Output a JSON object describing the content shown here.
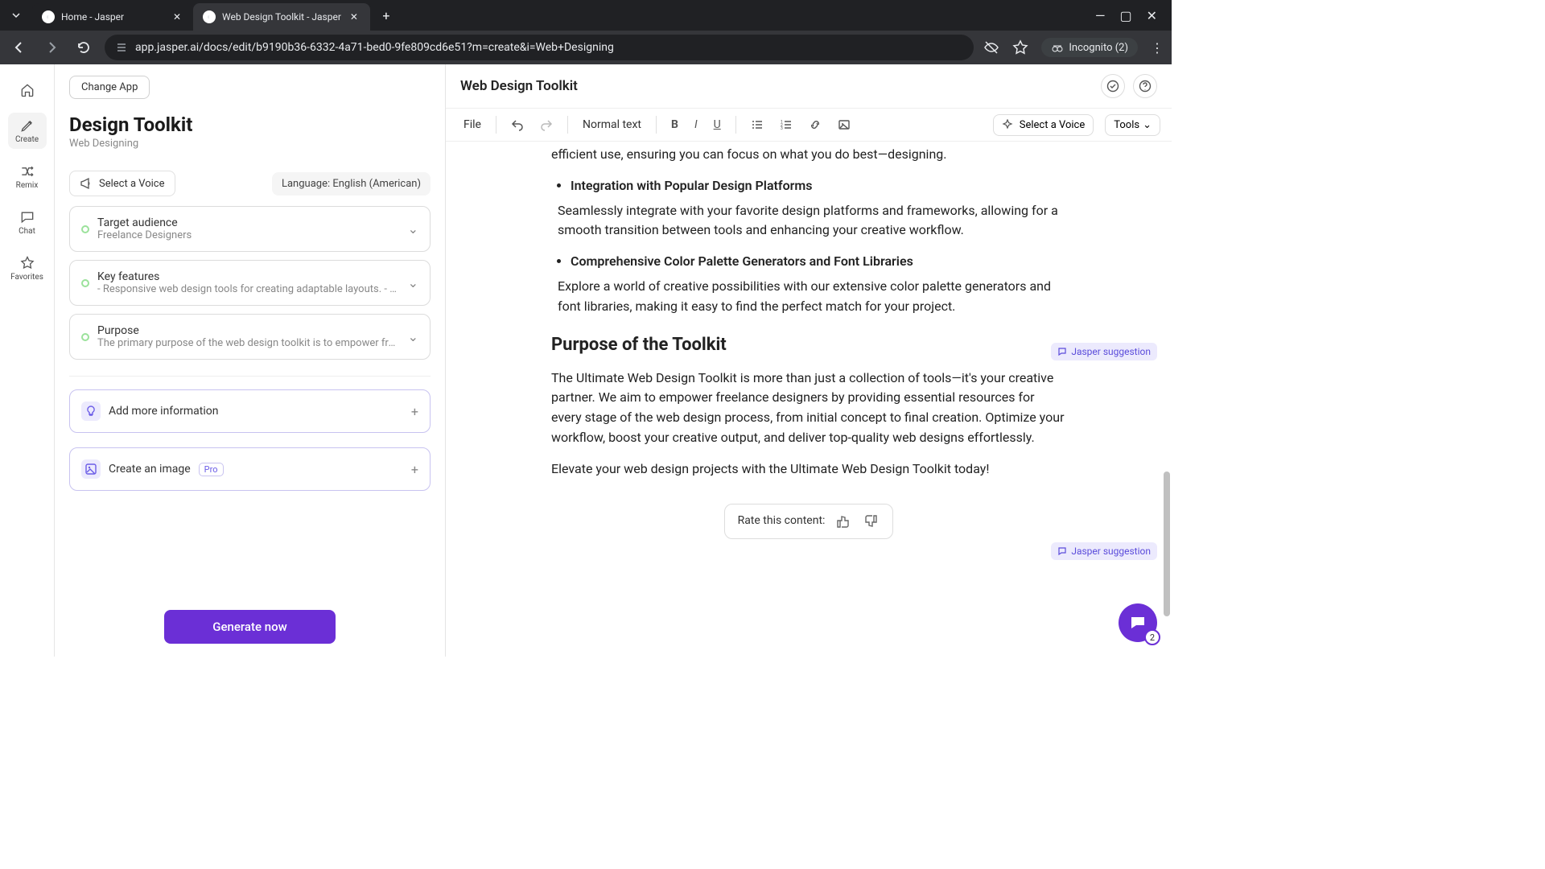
{
  "browser": {
    "tabs": [
      {
        "title": "Home - Jasper"
      },
      {
        "title": "Web Design Toolkit - Jasper"
      }
    ],
    "url": "app.jasper.ai/docs/edit/b9190b36-6332-4a71-bed0-9fe809cd6e51?m=create&i=Web+Designing",
    "incognito": "Incognito (2)"
  },
  "rail": {
    "home": "",
    "create": "Create",
    "remix": "Remix",
    "chat": "Chat",
    "favorites": "Favorites"
  },
  "panel": {
    "change_app": "Change App",
    "title": "Design Toolkit",
    "sub": "Web Designing",
    "voice": "Select a Voice",
    "language": "Language: English (American)",
    "cards": [
      {
        "title": "Target audience",
        "desc": "Freelance Designers"
      },
      {
        "title": "Key features",
        "desc": "- Responsive web design tools for creating adaptable layouts. - High-quali..."
      },
      {
        "title": "Purpose",
        "desc": "The primary purpose of the web design toolkit is to empower freelance desi..."
      }
    ],
    "add_more": "Add more information",
    "create_image": "Create an image",
    "pro": "Pro",
    "generate": "Generate now"
  },
  "editor": {
    "doc_title": "Web Design Toolkit",
    "file": "File",
    "normal_text": "Normal text",
    "select_voice": "Select a Voice",
    "tools": "Tools",
    "suggestion": "Jasper suggestion",
    "rate_label": "Rate this content:",
    "content": {
      "p0": "efficient use, ensuring you can focus on what you do best—designing.",
      "li1": "Integration with Popular Design Platforms",
      "p1": "Seamlessly integrate with your favorite design platforms and frameworks, allowing for a smooth transition between tools and enhancing your creative workflow.",
      "li2": "Comprehensive Color Palette Generators and Font Libraries",
      "p2": "Explore a world of creative possibilities with our extensive color palette generators and font libraries, making it easy to find the perfect match for your project.",
      "h2": "Purpose of the Toolkit",
      "p3": "The Ultimate Web Design Toolkit is more than just a collection of tools—it's your creative partner. We aim to empower freelance designers by providing essential resources for every stage of the web design process, from initial concept to final creation. Optimize your workflow, boost your creative output, and deliver top-quality web designs effortlessly.",
      "p4": "Elevate your web design projects with the Ultimate Web Design Toolkit today!"
    }
  },
  "chat_badge": "2"
}
